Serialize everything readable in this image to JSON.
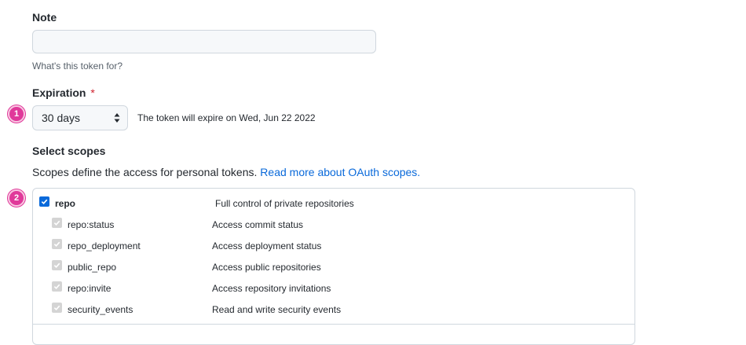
{
  "note": {
    "label": "Note",
    "value": "",
    "placeholder": "",
    "hint": "What's this token for?"
  },
  "expiration": {
    "label": "Expiration",
    "required_mark": "*",
    "selected": "30 days",
    "message": "The token will expire on Wed, Jun 22 2022"
  },
  "steps": [
    "1",
    "2"
  ],
  "scopes": {
    "title": "Select scopes",
    "description": "Scopes define the access for personal tokens.",
    "link_text": "Read more about OAuth scopes.",
    "parent": {
      "name": "repo",
      "description": "Full control of private repositories",
      "checked": true
    },
    "children": [
      {
        "name": "repo:status",
        "description": "Access commit status",
        "checked": true
      },
      {
        "name": "repo_deployment",
        "description": "Access deployment status",
        "checked": true
      },
      {
        "name": "public_repo",
        "description": "Access public repositories",
        "checked": true
      },
      {
        "name": "repo:invite",
        "description": "Access repository invitations",
        "checked": true
      },
      {
        "name": "security_events",
        "description": "Read and write security events",
        "checked": true
      }
    ]
  },
  "colors": {
    "accent": "#0969da",
    "step_badge": "#e0399a",
    "required": "#cf222e"
  }
}
